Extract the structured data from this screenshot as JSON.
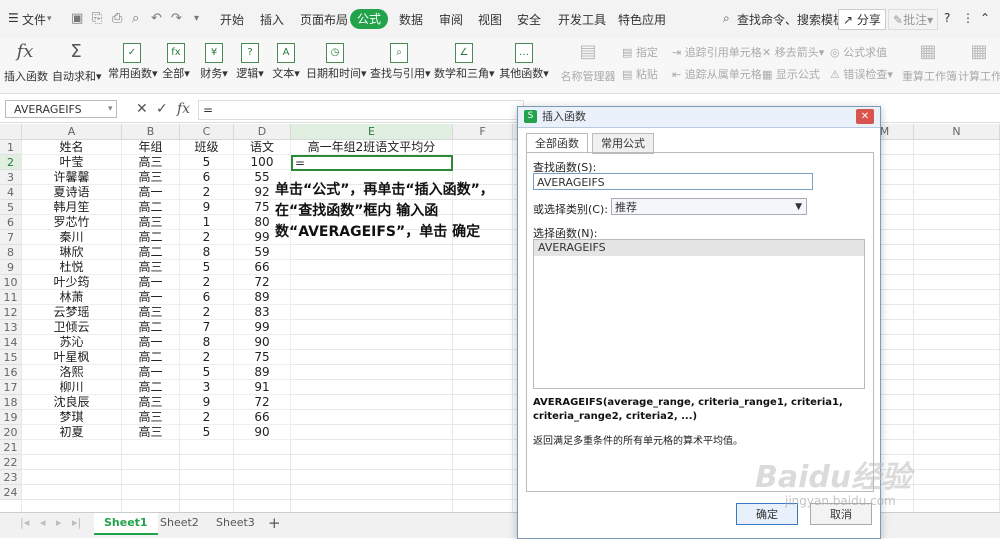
{
  "menubar": {
    "file_label": "文件",
    "tabs": [
      "开始",
      "插入",
      "页面布局",
      "公式",
      "数据",
      "审阅",
      "视图",
      "安全",
      "开发工具",
      "特色应用"
    ],
    "active_tab": "公式",
    "search_label": "查找命令、搜索模板",
    "share_label": "分享",
    "comment_label": "批注",
    "help_label": "?"
  },
  "toolbar": {
    "insert_function": "插入函数",
    "autosum": "自动求和",
    "common_functions": "常用函数",
    "all": "全部",
    "finance": "财务",
    "logic": "逻辑",
    "text": "文本",
    "datetime": "日期和时间",
    "lookup": "查找与引用",
    "math": "数学和三角",
    "other": "其他函数",
    "name_manager": "名称管理器",
    "specify": "指定",
    "paste": "粘贴",
    "trace_precedents": "追踪引用单元格",
    "trace_dependents": "追踪从属单元格",
    "remove_arrows": "移去箭头",
    "show_formulas": "显示公式",
    "formula_eval": "公式求值",
    "error_check": "错误检查",
    "recalc_sheet": "重算工作簿",
    "calc_sheet": "计算工作"
  },
  "formula_bar": {
    "name_box": "AVERAGEIFS",
    "content": "="
  },
  "sheet": {
    "columns": [
      "A",
      "B",
      "C",
      "D",
      "E",
      "F",
      "M",
      "N"
    ],
    "row_numbers": [
      "1",
      "2",
      "3",
      "4",
      "5",
      "6",
      "7",
      "8",
      "9",
      "10",
      "11",
      "12",
      "13",
      "14",
      "15",
      "16",
      "17",
      "18",
      "19",
      "20",
      "21",
      "22",
      "23",
      "24"
    ],
    "header_row": [
      "姓名",
      "年组",
      "班级",
      "语文",
      "高一年组2班语文平均分"
    ],
    "rows": [
      [
        "叶莹",
        "高三",
        "5",
        "100"
      ],
      [
        "许馨馨",
        "高三",
        "6",
        "55"
      ],
      [
        "夏诗语",
        "高一",
        "2",
        "92"
      ],
      [
        "韩月笙",
        "高二",
        "9",
        "75"
      ],
      [
        "罗芯竹",
        "高三",
        "1",
        "80"
      ],
      [
        "秦川",
        "高二",
        "2",
        "99"
      ],
      [
        "琳欣",
        "高二",
        "8",
        "59"
      ],
      [
        "杜悦",
        "高三",
        "5",
        "66"
      ],
      [
        "叶少筠",
        "高一",
        "2",
        "72"
      ],
      [
        "林萧",
        "高一",
        "6",
        "89"
      ],
      [
        "云梦瑶",
        "高三",
        "2",
        "83"
      ],
      [
        "卫倾云",
        "高二",
        "7",
        "99"
      ],
      [
        "苏沁",
        "高一",
        "8",
        "90"
      ],
      [
        "叶星枫",
        "高二",
        "2",
        "75"
      ],
      [
        "洛熙",
        "高一",
        "5",
        "89"
      ],
      [
        "柳川",
        "高二",
        "3",
        "91"
      ],
      [
        "沈良辰",
        "高三",
        "9",
        "72"
      ],
      [
        "梦琪",
        "高三",
        "2",
        "66"
      ],
      [
        "初夏",
        "高三",
        "5",
        "90"
      ]
    ],
    "active_cell_value": "=",
    "instruction": "单击“公式”，再单击“插入函数”，在“查找函数”框内 输入函数“AVERAGEIFS”，单击 确定"
  },
  "sheet_tabs": [
    "Sheet1",
    "Sheet2",
    "Sheet3"
  ],
  "dialog": {
    "title": "插入函数",
    "tab_all": "全部函数",
    "tab_common": "常用公式",
    "search_label": "查找函数(S):",
    "search_value": "AVERAGEIFS",
    "category_label": "或选择类别(C):",
    "category_value": "推荐",
    "select_label": "选择函数(N):",
    "selected_function": "AVERAGEIFS",
    "syntax": "AVERAGEIFS(average_range, criteria_range1, criteria1, criteria_range2, criteria2, ...)",
    "description": "返回满足多重条件的所有单元格的算术平均值。",
    "ok": "确定",
    "cancel": "取消"
  },
  "watermark": {
    "main": "Baidu经验",
    "sub": "jingyan.baidu.com"
  },
  "colors": {
    "accent_green": "#22a34b",
    "dialog_border": "#7a9ab8"
  }
}
